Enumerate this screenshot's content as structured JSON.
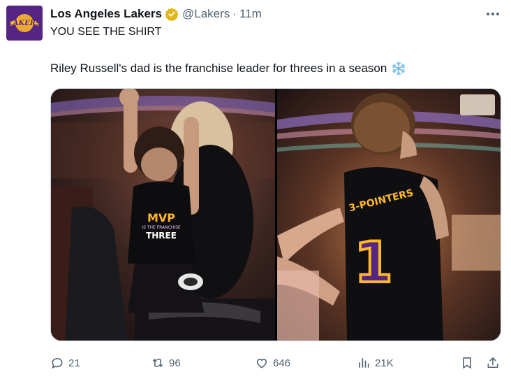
{
  "tweet": {
    "author": {
      "display_name": "Los Angeles Lakers",
      "handle": "@Lakers",
      "avatar_logo_text": "LAKERS"
    },
    "separator": "·",
    "time": "11m",
    "text_line1": "YOU SEE THE SHIRT",
    "text_line2": "Riley Russell's dad is the franchise leader for threes in a season",
    "emoji": "snowflake-icon"
  },
  "media": {
    "left_shirt_text": [
      "MVP",
      "IS THE FRANCHISE",
      "THREE"
    ],
    "right_shirt_text": [
      "3-POINTERS",
      "1"
    ]
  },
  "actions": {
    "replies": "21",
    "reposts": "96",
    "likes": "646",
    "views": "21K"
  },
  "colors": {
    "lakers_purple": "#552583",
    "lakers_gold": "#fdb927",
    "verified_gold": "#e2b719",
    "secondary_text": "#536471",
    "snowflake": "#7cc2ea"
  }
}
